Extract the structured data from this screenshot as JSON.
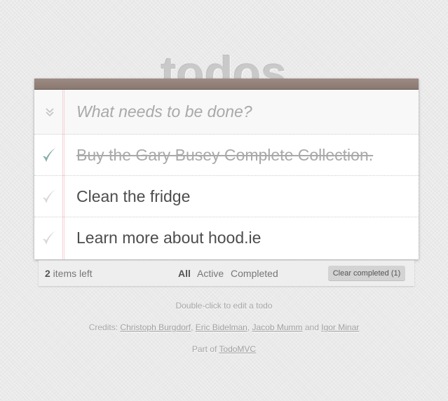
{
  "app": {
    "title": "todos"
  },
  "new_todo": {
    "placeholder": "What needs to be done?",
    "value": ""
  },
  "todos": [
    {
      "label": "Buy the Gary Busey Complete Collection.",
      "completed": true
    },
    {
      "label": "Clean the fridge",
      "completed": false
    },
    {
      "label": "Learn more about hood.ie",
      "completed": false
    }
  ],
  "footer": {
    "count": "2",
    "count_suffix": " items left",
    "filters": [
      "All",
      "Active",
      "Completed"
    ],
    "selected_filter": "All",
    "clear_completed": "Clear completed (1)"
  },
  "info": {
    "edit_hint": "Double-click to edit a todo",
    "credits_prefix": "Credits: ",
    "credits": [
      "Christoph Burgdorf",
      "Eric Bidelman",
      "Jacob Mumm",
      "Igor Minar"
    ],
    "sep_comma": ", ",
    "sep_and": " and ",
    "part_of_prefix": "Part of ",
    "part_of_link": "TodoMVC"
  },
  "colors": {
    "checkmark_done": "#85ada7",
    "checkmark_todo": "#d9d9d9",
    "header_bar": "#8d7d77",
    "title": "#c9c9c9"
  }
}
